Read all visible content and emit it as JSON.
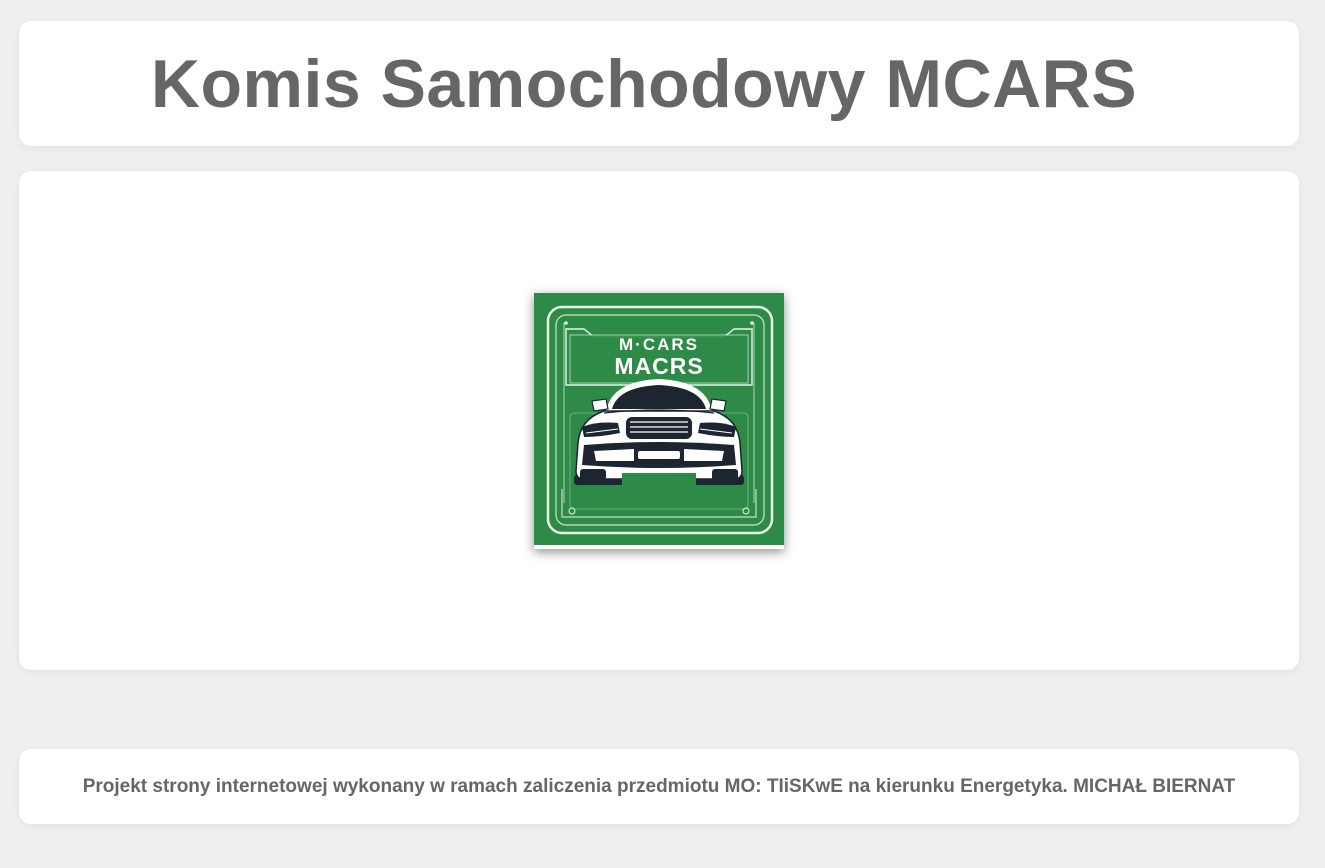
{
  "header": {
    "title": "Komis Samochodowy MCARS"
  },
  "main": {
    "logo": {
      "icon": "mcars-car-logo",
      "line1": "M·CARS",
      "line2": "MACRS",
      "colors": {
        "background": "#2e8b47",
        "frame": "#e8f3ea",
        "car_body": "#ffffff",
        "car_dark": "#1c2530"
      }
    }
  },
  "footer": {
    "text": "Projekt strony internetowej wykonany w ramach zaliczenia przedmiotu MO: TIiSKwE na kierunku Energetyka. MICHAŁ BIERNAT"
  },
  "colors": {
    "page_bg": "#efefef",
    "card_bg": "#ffffff",
    "text": "#666666"
  }
}
